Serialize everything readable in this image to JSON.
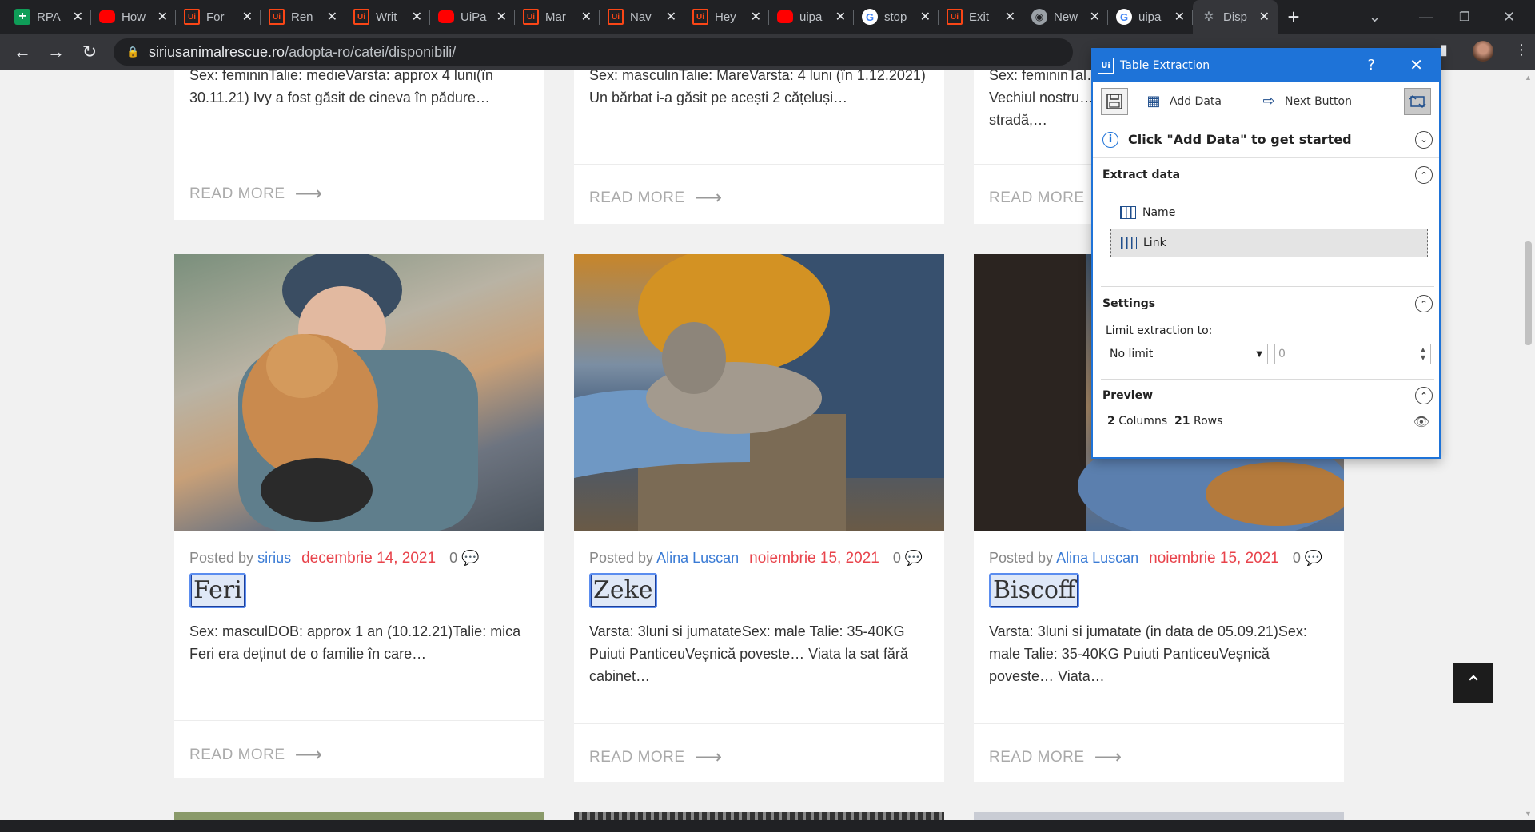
{
  "browser": {
    "tabs": [
      {
        "icon": "sheets",
        "glyph": "+",
        "title": "RPA"
      },
      {
        "icon": "yt",
        "glyph": "",
        "title": "How"
      },
      {
        "icon": "ui",
        "glyph": "Ui",
        "title": "For"
      },
      {
        "icon": "ui",
        "glyph": "Ui",
        "title": "Ren"
      },
      {
        "icon": "ui",
        "glyph": "Ui",
        "title": "Writ"
      },
      {
        "icon": "yt",
        "glyph": "",
        "title": "UiPa"
      },
      {
        "icon": "ui",
        "glyph": "Ui",
        "title": "Mar"
      },
      {
        "icon": "ui",
        "glyph": "Ui",
        "title": "Nav"
      },
      {
        "icon": "ui",
        "glyph": "Ui",
        "title": "Hey"
      },
      {
        "icon": "yt",
        "glyph": "",
        "title": "uipa"
      },
      {
        "icon": "g",
        "glyph": "G",
        "title": "stop"
      },
      {
        "icon": "ui",
        "glyph": "Ui",
        "title": "Exit"
      },
      {
        "icon": "chrome",
        "glyph": "◉",
        "title": "New"
      },
      {
        "icon": "g",
        "glyph": "G",
        "title": "uipa"
      },
      {
        "icon": "paw",
        "glyph": "✲",
        "title": "Disp"
      }
    ],
    "new_tab": "+",
    "url_domain": "siriusanimalrescue.ro",
    "url_path": "/adopta-ro/catei/disponibili/"
  },
  "page": {
    "read_more": "READ MORE",
    "top_cards": [
      {
        "text": "Sex: femininTalie: medieVarsta: approx 4 luni(în 30.11.21) Ivy a fost găsit de cineva în pădure…"
      },
      {
        "text": "Sex: masculinTalie: MareVarsta: 4 luni (în 1.12.2021) Un bărbat i-a găsit pe acești 2 cățeluși…"
      },
      {
        "text": "Sex: femininTal… Vechiul nostru… stradă,…"
      }
    ],
    "cards": [
      {
        "posted_by": "Posted by",
        "author": "sirius",
        "date": "decembrie 14, 2021",
        "comments": "0",
        "name": "Feri",
        "text": "Sex: masculDOB: approx 1 an (10.12.21)Talie: mica Feri era deținut de o familie în care…"
      },
      {
        "posted_by": "Posted by",
        "author": "Alina Luscan",
        "date": "noiembrie 15, 2021",
        "comments": "0",
        "name": "Zeke",
        "text": "Varsta: 3luni si jumatateSex: male Talie: 35-40KG Puiuti PanticeuVeșnică poveste… Viata la sat fără cabinet…"
      },
      {
        "posted_by": "Posted by",
        "author": "Alina Luscan",
        "date": "noiembrie 15, 2021",
        "comments": "0",
        "name": "Biscoff",
        "text": "Varsta: 3luni si jumatate (in data de 05.09.21)Sex: male Talie: 35-40KG Puiuti PanticeuVeșnică poveste… Viata…"
      }
    ]
  },
  "dialog": {
    "title": "Table Extraction",
    "help": "?",
    "add_data": "Add Data",
    "next_button": "Next Button",
    "info": "Click \"Add Data\" to get started",
    "extract_data": "Extract data",
    "fields": [
      "Name",
      "Link"
    ],
    "settings": "Settings",
    "limit_label": "Limit extraction to:",
    "limit_value": "No limit",
    "limit_count": "0",
    "preview": "Preview",
    "columns_count": "2",
    "columns_label": "Columns",
    "rows_count": "21",
    "rows_label": "Rows"
  },
  "colors": {
    "accent": "#1e73d8",
    "date": "#e8434b",
    "author": "#3a7bd5"
  }
}
